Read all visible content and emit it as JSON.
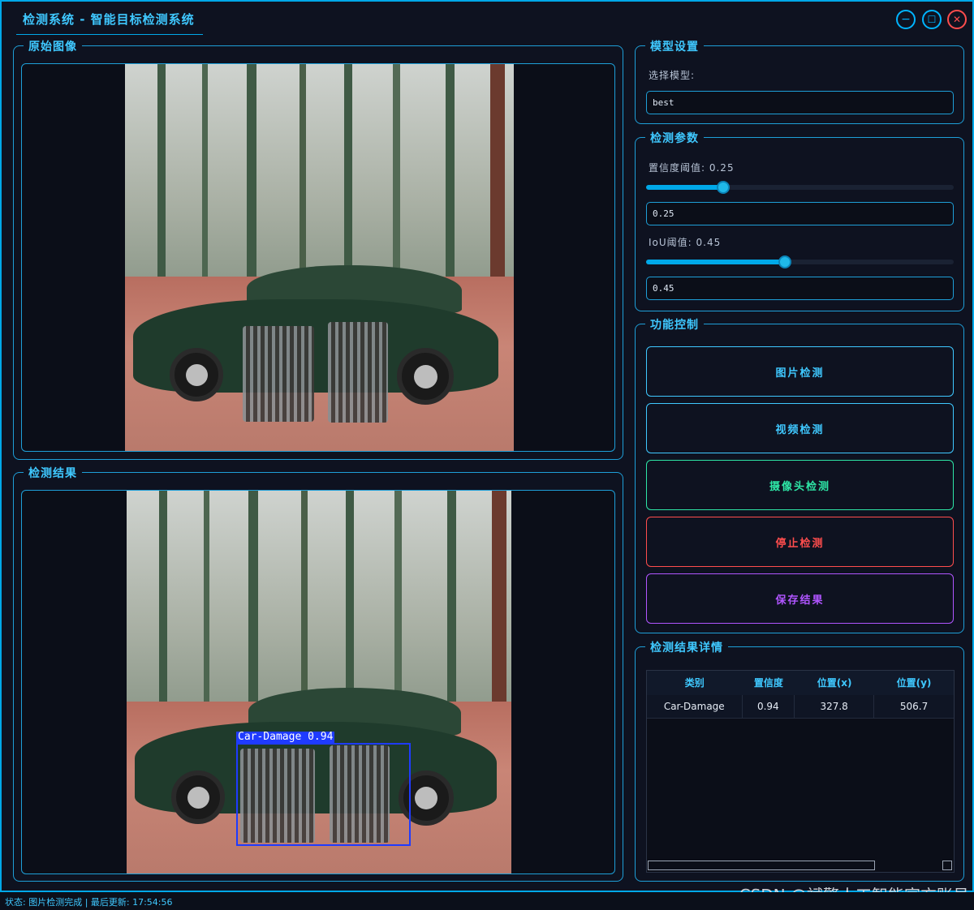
{
  "window": {
    "title": "检测系统 - 智能目标检测系统",
    "controls": {
      "minimize": "−",
      "maximize": "☐",
      "close": "✕"
    }
  },
  "original_panel": {
    "title": "原始图像"
  },
  "result_panel": {
    "title": "检测结果",
    "detection_label": "Car-Damage 0.94"
  },
  "model_settings": {
    "title": "模型设置",
    "select_label": "选择模型:",
    "selected_model": "best"
  },
  "detection_params": {
    "title": "检测参数",
    "confidence_label": "置信度阈值: 0.25",
    "confidence_value": "0.25",
    "confidence_level": 0.25,
    "iou_label": "IoU阈值: 0.45",
    "iou_value": "0.45",
    "iou_level": 0.45
  },
  "function_control": {
    "title": "功能控制",
    "buttons": [
      {
        "label": "图片检测",
        "color": "#3fc8ff"
      },
      {
        "label": "视频检测",
        "color": "#3fc8ff"
      },
      {
        "label": "摄像头检测",
        "color": "#2ee6a6"
      },
      {
        "label": "停止检测",
        "color": "#ff4d4d"
      },
      {
        "label": "保存结果",
        "color": "#b055ff"
      }
    ]
  },
  "results_details": {
    "title": "检测结果详情",
    "columns": [
      "类别",
      "置信度",
      "位置(x)",
      "位置(y)"
    ],
    "rows": [
      [
        "Car-Damage",
        "0.94",
        "327.8",
        "506.7"
      ]
    ]
  },
  "status": {
    "text": "状态: 图片检测完成 | 最后更新: 17:54:56"
  },
  "watermark": "CSDN @斌擎人工智能官方账号",
  "colors": {
    "accent": "#00a8e8",
    "bbox": "#1f3bff",
    "danger": "#ff4d4d"
  }
}
